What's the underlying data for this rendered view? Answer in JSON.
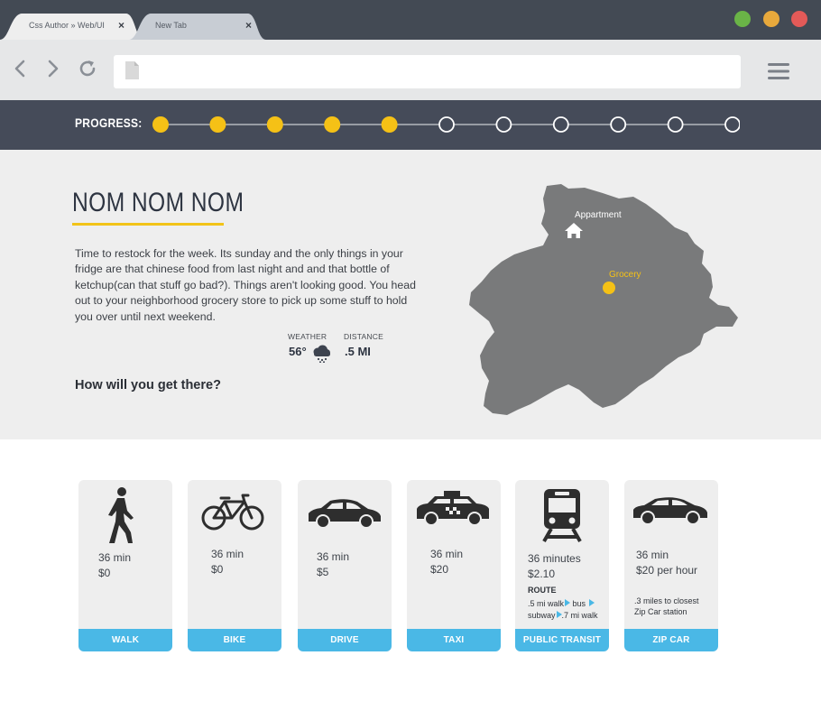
{
  "browser": {
    "tabs": [
      {
        "label": "Css Author » Web/UI",
        "close": "×"
      },
      {
        "label": "New Tab",
        "close": "×"
      }
    ],
    "window_buttons": [
      {
        "name": "maximize",
        "color": "#6ab447"
      },
      {
        "name": "minimize",
        "color": "#e8a93c"
      },
      {
        "name": "close",
        "color": "#e35a58"
      }
    ],
    "icons": [
      "back-arrow-icon",
      "forward-arrow-icon",
      "reload-icon",
      "page-icon",
      "hamburger-menu-icon"
    ],
    "address": ""
  },
  "progress": {
    "label": "PROGRESS:",
    "total_steps": 11,
    "completed_steps": 5,
    "filled_color": "#f5c116",
    "empty_color": "#ffffff"
  },
  "hero": {
    "title": "NOM NOM NOM",
    "body": "Time to restock for the week. Its sunday and the only things in your fridge are that chinese food from last night and and that bottle of ketchup(can that stuff go bad?). Things aren't looking good. You head out to your neighborhood grocery store to pick up some stuff to hold you over until next weekend.",
    "weather_label": "WEATHER",
    "weather_value": "56°",
    "weather_icon": "rain-cloud-icon",
    "distance_label": "DISTANCE",
    "distance_value": ".5 MI",
    "question": "How will you get there?"
  },
  "map": {
    "home_label": "Appartment",
    "home_icon": "house-icon",
    "destination_label": "Grocery",
    "destination_color": "#f5c116"
  },
  "options": [
    {
      "id": "walk",
      "icon": "walking-person-icon",
      "time": "36 min",
      "cost": "$0",
      "button": "WALK"
    },
    {
      "id": "bike",
      "icon": "bicycle-icon",
      "time": "36 min",
      "cost": "$0",
      "button": "BIKE"
    },
    {
      "id": "drive",
      "icon": "car-icon",
      "time": "36 min",
      "cost": "$5",
      "button": "DRIVE"
    },
    {
      "id": "taxi",
      "icon": "taxi-icon",
      "time": "36 min",
      "cost": "$20",
      "button": "TAXI"
    },
    {
      "id": "transit",
      "icon": "train-icon",
      "time": "36 minutes",
      "cost": "$2.10",
      "route_label": "ROUTE",
      "route_walk": ".5 mi walk",
      "route_bus": "bus",
      "route_subway": "subway",
      "route_walk2": ".7 mi walk",
      "button": "PUBLIC TRANSIT"
    },
    {
      "id": "zipcar",
      "icon": "sedan-icon",
      "time": "36 min",
      "cost": "$20 per hour",
      "note_line1": ".3 miles to closest",
      "note_line2": "Zip Car station",
      "button": "ZIP CAR"
    }
  ]
}
